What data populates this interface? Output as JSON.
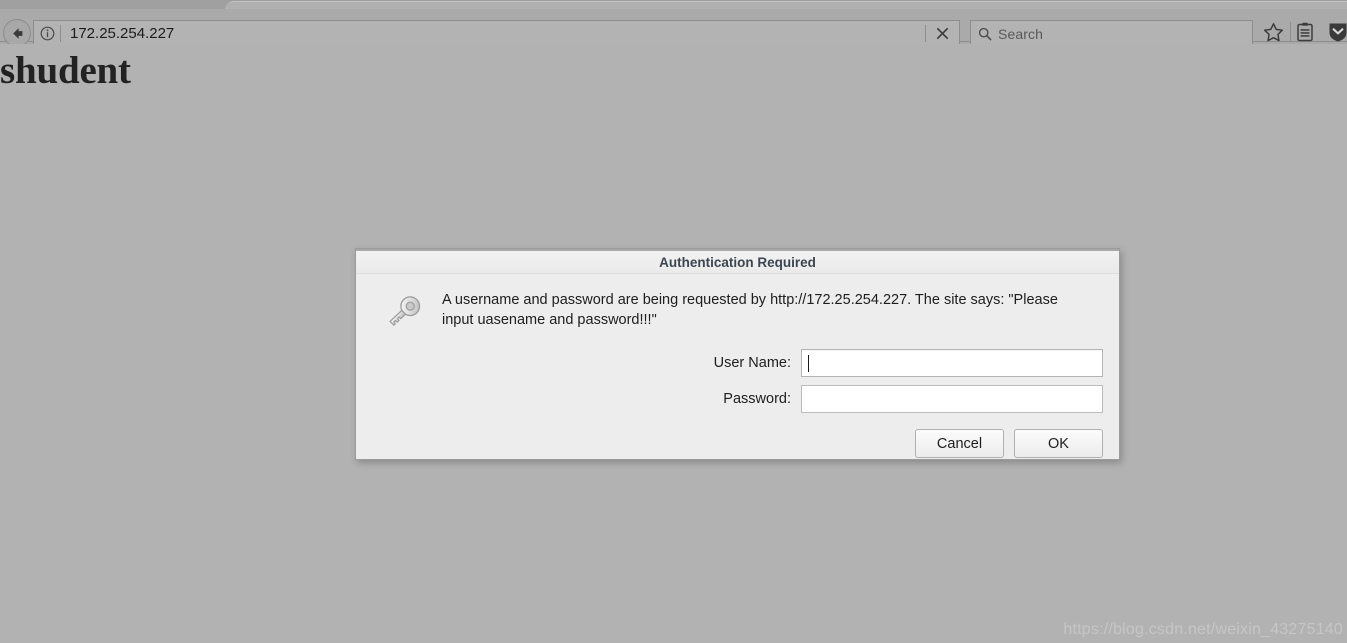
{
  "browser": {
    "back_button": "Back",
    "identity_icon": "info-circle-icon",
    "url": "172.25.254.227",
    "stop_button_icon": "close-x-icon",
    "search_placeholder": "Search",
    "search_icon": "magnifier-icon",
    "bookmark_icon": "star-icon",
    "library_icon": "library-list-icon",
    "shield_icon": "shield-chevron-down-icon"
  },
  "page": {
    "heading": "shudent",
    "watermark": "https://blog.csdn.net/weixin_43275140"
  },
  "dialog": {
    "title": "Authentication Required",
    "icon": "key-icon",
    "message": "A username and password are being requested by http://172.25.254.227. The site says: \"Please input uasename and password!!!\"",
    "fields": [
      {
        "label": "User Name:",
        "value": "",
        "name": "username",
        "focused": true
      },
      {
        "label": "Password:",
        "value": "",
        "name": "password",
        "focused": false
      }
    ],
    "buttons": {
      "cancel": "Cancel",
      "ok": "OK"
    }
  },
  "colors": {
    "page_background": "#b2b2b2",
    "chrome_background": "#a9a9a9",
    "dialog_background": "#ededed",
    "dialog_title_text": "#3c4650",
    "watermark_text": "#c6c6c6"
  }
}
